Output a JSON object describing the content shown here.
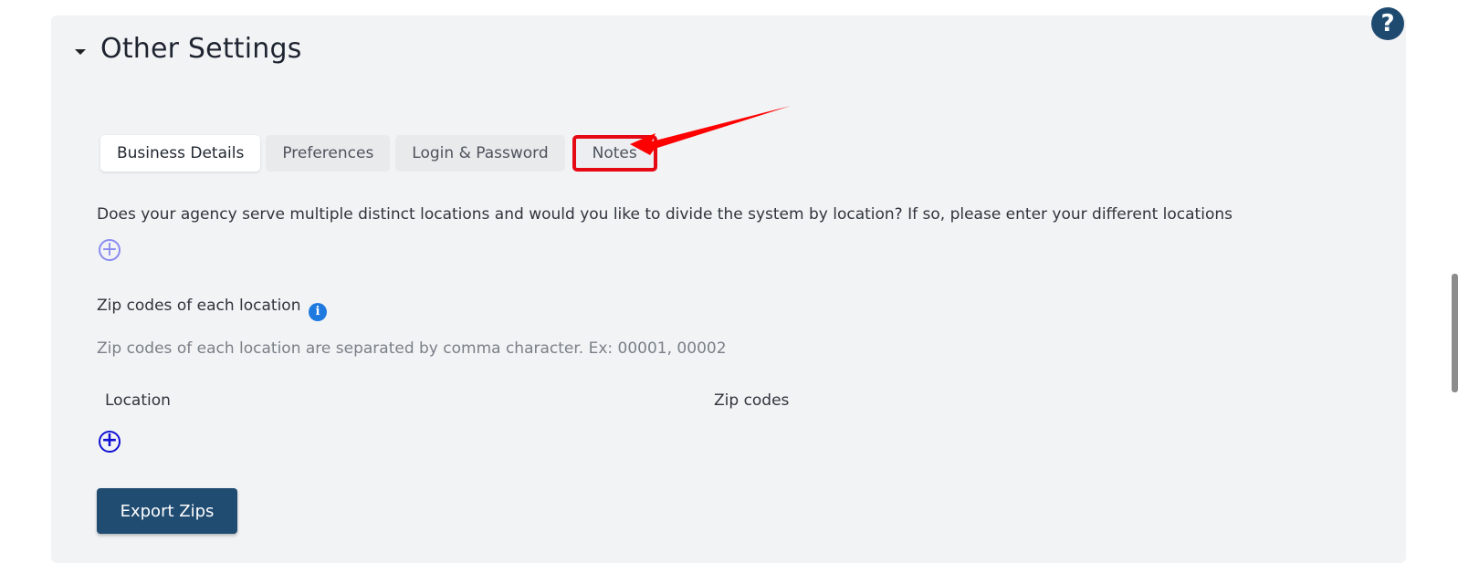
{
  "section": {
    "title": "Other Settings",
    "help_icon": "question-icon"
  },
  "tabs": [
    {
      "label": "Business Details",
      "active": true
    },
    {
      "label": "Preferences",
      "active": false
    },
    {
      "label": "Login & Password",
      "active": false
    },
    {
      "label": "Notes",
      "active": false,
      "highlighted": true
    }
  ],
  "annotation": {
    "highlight_color": "#e50914",
    "arrow_target": "Notes"
  },
  "locations": {
    "question": "Does your agency serve multiple distinct locations and would you like to divide the system by location? If so, please enter your different locations",
    "add_icon": "plus-circle-icon"
  },
  "zip_codes": {
    "label": "Zip codes of each location",
    "info_icon": "info-icon",
    "helper": "Zip codes of each location are separated by comma character. Ex: 00001, 00002",
    "columns": [
      "Location",
      "Zip codes"
    ],
    "add_icon": "plus-circle-icon"
  },
  "actions": {
    "export_label": "Export Zips"
  },
  "colors": {
    "primary": "#214c72",
    "panel_bg": "#f2f3f5",
    "info": "#1f7ae0",
    "add_light": "#8a8cf0",
    "add_dark": "#1212d6"
  }
}
